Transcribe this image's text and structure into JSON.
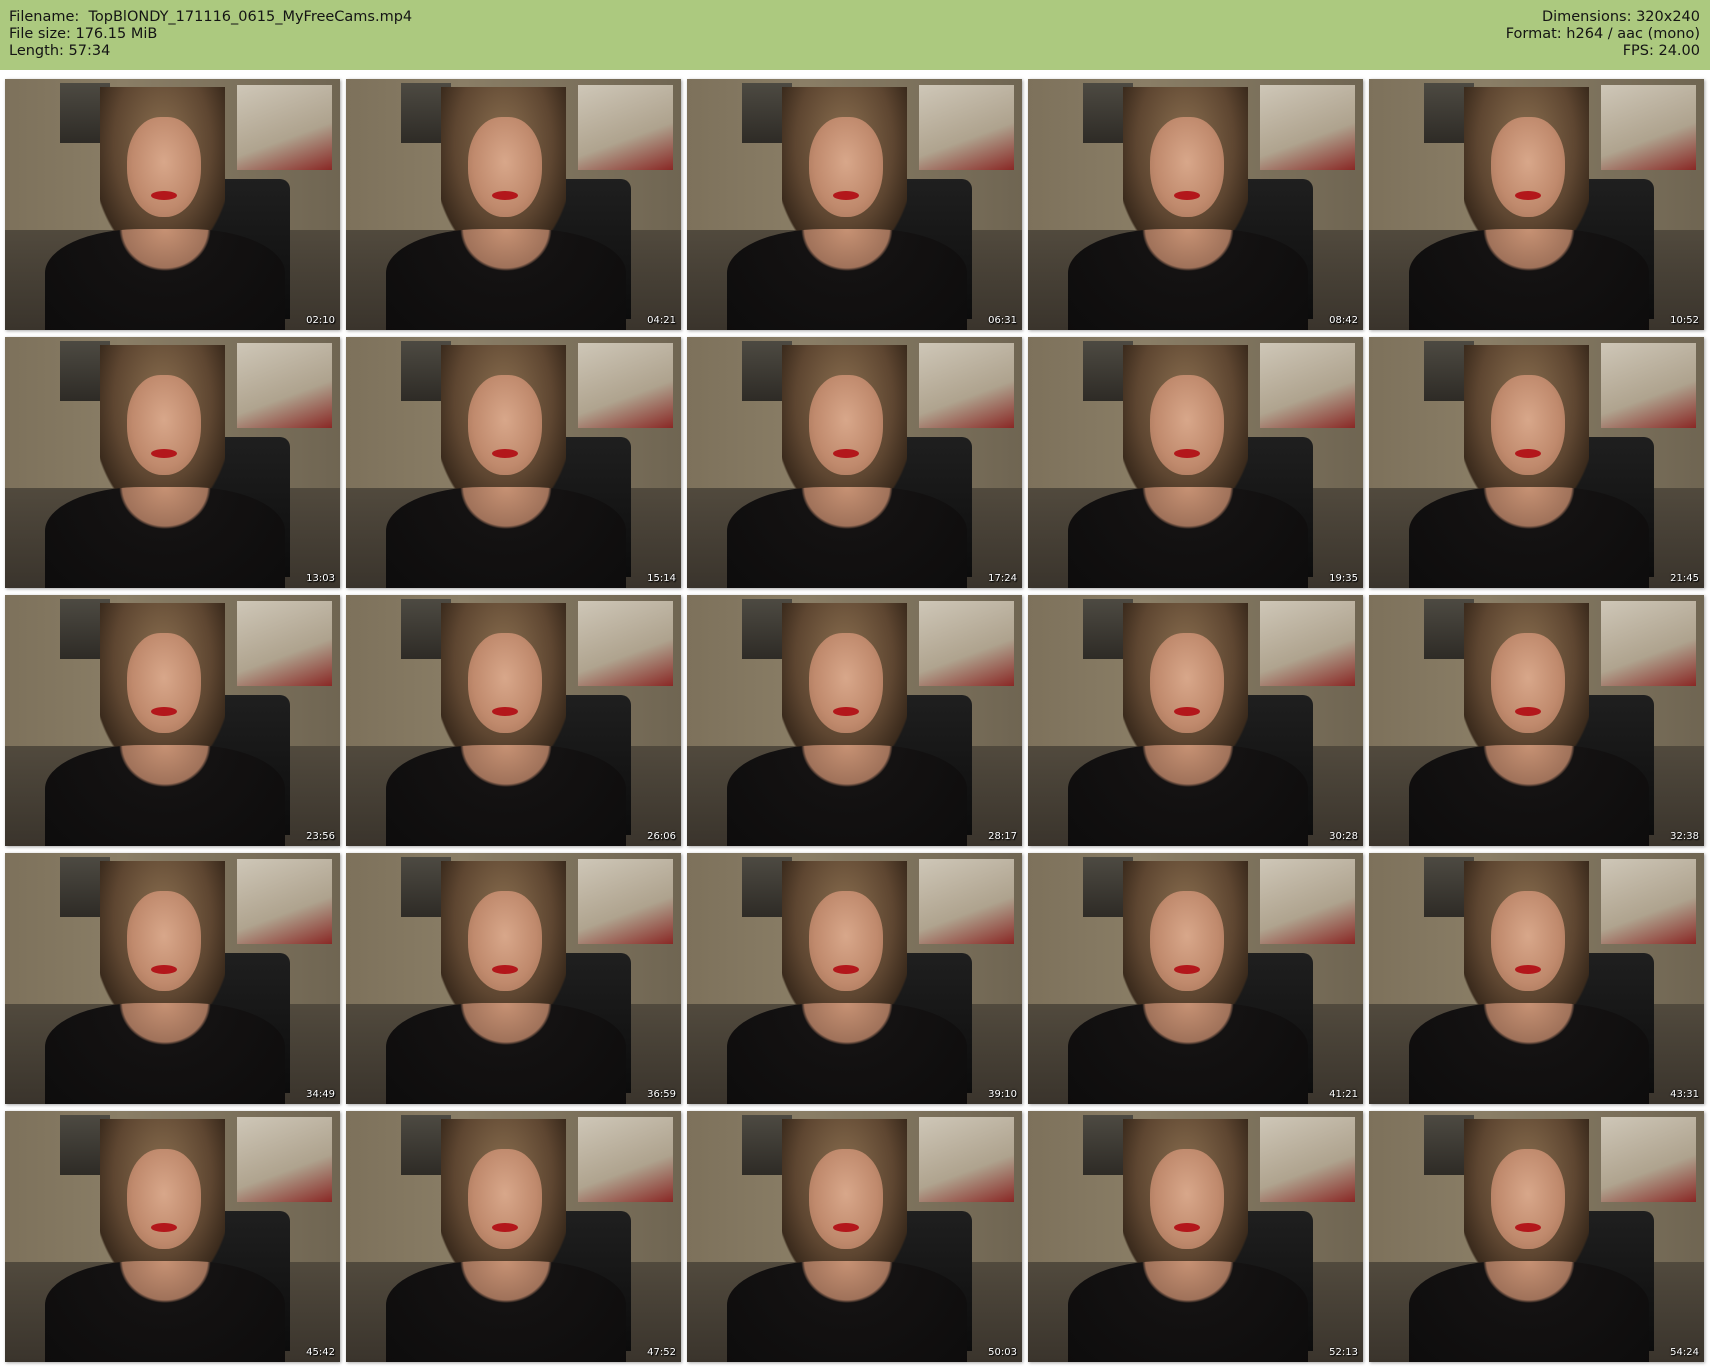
{
  "header": {
    "filename_label": "Filename:",
    "filename": "TopBlONDY_171116_0615_MyFreeCams.mp4",
    "filesize_label": "File size:",
    "filesize": "176.15 MiB",
    "length_label": "Length:",
    "length": "57:34",
    "dimensions_label": "Dimensions:",
    "dimensions": "320x240",
    "format_label": "Format:",
    "format": "h264 / aac (mono)",
    "fps_label": "FPS:",
    "fps": "24.00"
  },
  "colors": {
    "header_bg": "#acc97f",
    "timestamp_text": "#ffffff"
  },
  "thumbnails": [
    {
      "time": "02:10"
    },
    {
      "time": "04:21"
    },
    {
      "time": "06:31"
    },
    {
      "time": "08:42"
    },
    {
      "time": "10:52"
    },
    {
      "time": "13:03"
    },
    {
      "time": "15:14"
    },
    {
      "time": "17:24"
    },
    {
      "time": "19:35"
    },
    {
      "time": "21:45"
    },
    {
      "time": "23:56"
    },
    {
      "time": "26:06"
    },
    {
      "time": "28:17"
    },
    {
      "time": "30:28"
    },
    {
      "time": "32:38"
    },
    {
      "time": "34:49"
    },
    {
      "time": "36:59"
    },
    {
      "time": "39:10"
    },
    {
      "time": "41:21"
    },
    {
      "time": "43:31"
    },
    {
      "time": "45:42"
    },
    {
      "time": "47:52"
    },
    {
      "time": "50:03"
    },
    {
      "time": "52:13"
    },
    {
      "time": "54:24"
    }
  ]
}
